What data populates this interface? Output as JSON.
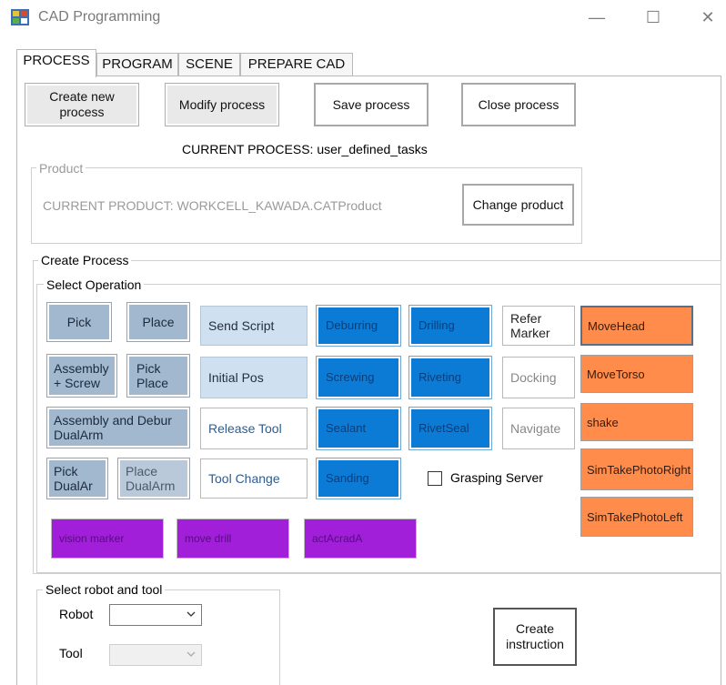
{
  "window": {
    "title": "CAD Programming",
    "minimize_glyph": "—",
    "maximize_glyph": "☐",
    "close_glyph": "✕"
  },
  "tabs": [
    "PROCESS",
    "PROGRAM",
    "SCENE",
    "PREPARE CAD"
  ],
  "toolbar": {
    "create_new": "Create new process",
    "modify": "Modify process",
    "save": "Save process",
    "close": "Close process"
  },
  "current_process": "CURRENT PROCESS: user_defined_tasks",
  "product": {
    "group_title": "Product",
    "current_product": "CURRENT PRODUCT: WORKCELL_KAWADA.CATProduct",
    "change_button": "Change product"
  },
  "create_process": {
    "group_title": "Create Process",
    "select_operation_title": "Select Operation",
    "ops": {
      "pick": "Pick",
      "place": "Place",
      "send_script": "Send Script",
      "deburring": "Deburring",
      "drilling": "Drilling",
      "refer_marker": "Refer Marker",
      "move_head": "MoveHead",
      "assembly_screw": "Assembly + Screw",
      "pick_place": "Pick Place",
      "initial_pos": "Initial Pos",
      "screwing": "Screwing",
      "riveting": "Riveting",
      "docking": "Docking",
      "move_torso": "MoveTorso",
      "assembly_debur_dualarm": "Assembly and Debur DualArm",
      "release_tool": "Release Tool",
      "sealant": "Sealant",
      "rivet_seal": "RivetSeal",
      "navigate": "Navigate",
      "shake": "shake",
      "pick_dualarm": "Pick DualAr",
      "place_dualarm": "Place DualArm",
      "tool_change": "Tool Change",
      "sanding": "Sanding",
      "sim_take_photo_right": "SimTakePhotoRight",
      "sim_take_photo_left": "SimTakePhotoLeft",
      "vision_marker": "vision marker",
      "move_drill": "move drill",
      "act_a_cradle_a": "actAcradA"
    },
    "grasping_server_label": "Grasping Server"
  },
  "robot_tool": {
    "group_title": "Select robot and tool",
    "robot_label": "Robot",
    "tool_label": "Tool",
    "robot_value": "",
    "tool_value": ""
  },
  "create_instruction": "Create instruction",
  "colors": {
    "gray_op": "#a2b8cf",
    "light_op": "#cfe0f0",
    "blue_op": "#0c7bd6",
    "orange_op": "#ff8c4a",
    "purple_op": "#a11fd8"
  },
  "icons": {
    "app": "cad-app-icon",
    "dropdown": "chevron-down-icon"
  }
}
